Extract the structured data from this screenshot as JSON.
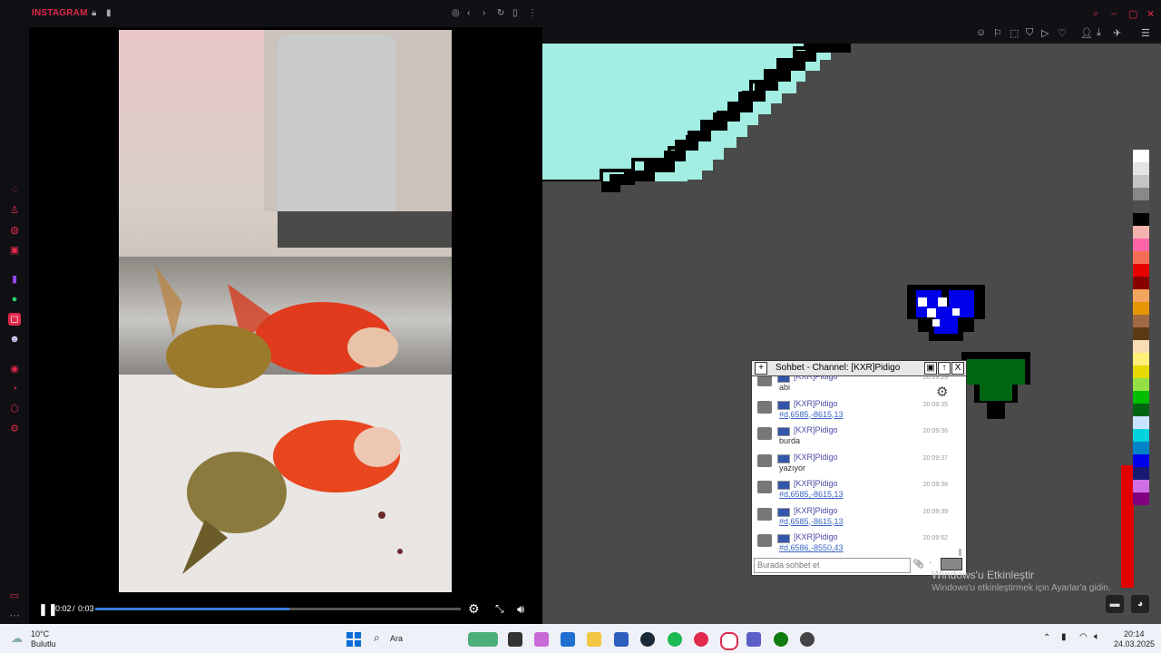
{
  "panel": {
    "title": "INSTAGRAM",
    "time_current": "0:02",
    "time_sep": "/",
    "time_total": "0:03",
    "progress": 0.53
  },
  "chat": {
    "title": "Sohbet - Channel: [KXR]Pidigo",
    "plus": "+",
    "up": "↑",
    "close": "X",
    "input_placeholder": "Burada sohbet et",
    "messages": [
      {
        "name": "[KXR]Pidigo",
        "text": "abi",
        "time": "20:09:29",
        "link": false
      },
      {
        "name": "[KXR]Pidigo",
        "text": "#d,6585,-8615,13",
        "time": "20:09:35",
        "link": true
      },
      {
        "name": "[KXR]Pidigo",
        "text": "burda",
        "time": "20:09:36",
        "link": false
      },
      {
        "name": "[KXR]Pidigo",
        "text": "yazıyor",
        "time": "20:09:37",
        "link": false
      },
      {
        "name": "[KXR]Pidigo",
        "text": "#d,6585,-8615,13",
        "time": "20:09:38",
        "link": true
      },
      {
        "name": "[KXR]Pidigo",
        "text": "#d,6585,-8615,13",
        "time": "20:09:39",
        "link": true
      },
      {
        "name": "[KXR]Pidigo",
        "text": "#d,6586,-8550,43",
        "time": "20:09:52",
        "link": true
      }
    ]
  },
  "watermark": {
    "line1": "Windows'u Etkinleştir",
    "line2": "Windows'u etkinleştirmek için Ayarlar'a gidin."
  },
  "taskbar": {
    "weather_temp": "10°C",
    "weather_desc": "Bulutlu",
    "search_label": "Ara",
    "clock_time": "20:14",
    "clock_date": "24.03.2025"
  },
  "palette": [
    "#ffffff",
    "#e4e4e4",
    "#c4c4c4",
    "#888888",
    "#4e4e4e",
    "#000000",
    "#f4b3ae",
    "#ff65a6",
    "#f36d55",
    "#e50000",
    "#880000",
    "#f4a55d",
    "#e59500",
    "#a06a42",
    "#5c3a16",
    "#f8dcb4",
    "#fff078",
    "#e5d900",
    "#94e044",
    "#02be01",
    "#006513",
    "#cae3ff",
    "#00d3dd",
    "#0083c7",
    "#0000ea",
    "#191973",
    "#cf6ee4",
    "#820080"
  ],
  "colors": {
    "accent": "#e0294b",
    "canvas_bg": "#4a4a4a",
    "sky": "#a2eee2"
  }
}
